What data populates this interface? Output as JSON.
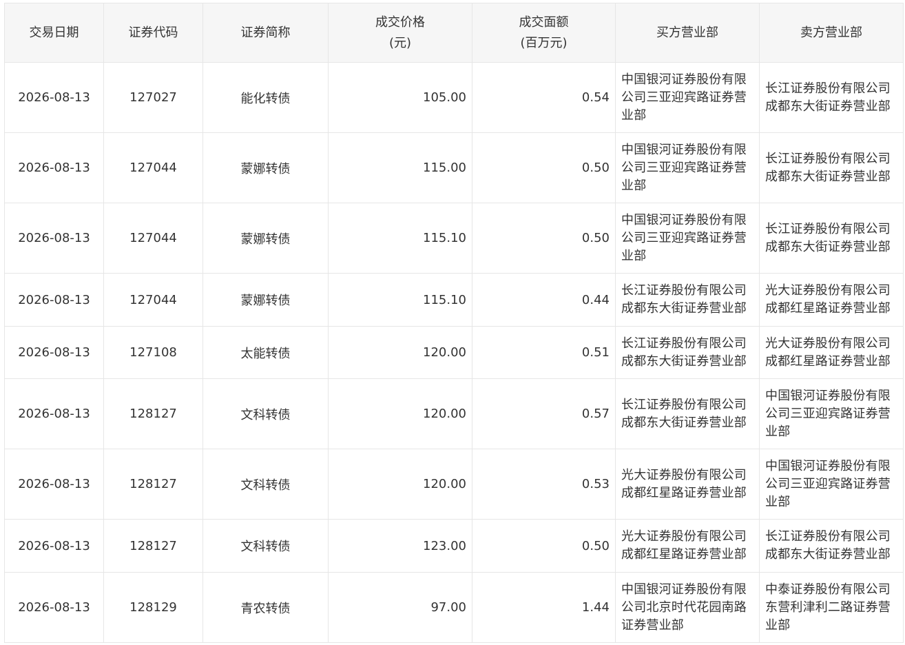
{
  "table": {
    "headers": {
      "date": "交易日期",
      "code": "证券代码",
      "name": "证券简称",
      "price_line1": "成交价格",
      "price_line2": "(元)",
      "amount_line1": "成交面额",
      "amount_line2": "(百万元)",
      "buyer": "买方营业部",
      "seller": "卖方营业部"
    },
    "rows": [
      {
        "date": "2026-08-13",
        "code": "127027",
        "name": "能化转债",
        "price": "105.00",
        "amount": "0.54",
        "buyer": "中国银河证券股份有限公司三亚迎宾路证券营业部",
        "seller": "长江证券股份有限公司成都东大街证券营业部"
      },
      {
        "date": "2026-08-13",
        "code": "127044",
        "name": "蒙娜转债",
        "price": "115.00",
        "amount": "0.50",
        "buyer": "中国银河证券股份有限公司三亚迎宾路证券营业部",
        "seller": "长江证券股份有限公司成都东大街证券营业部"
      },
      {
        "date": "2026-08-13",
        "code": "127044",
        "name": "蒙娜转债",
        "price": "115.10",
        "amount": "0.50",
        "buyer": "中国银河证券股份有限公司三亚迎宾路证券营业部",
        "seller": "长江证券股份有限公司成都东大街证券营业部"
      },
      {
        "date": "2026-08-13",
        "code": "127044",
        "name": "蒙娜转债",
        "price": "115.10",
        "amount": "0.44",
        "buyer": "长江证券股份有限公司成都东大街证券营业部",
        "seller": "光大证券股份有限公司成都红星路证券营业部"
      },
      {
        "date": "2026-08-13",
        "code": "127108",
        "name": "太能转债",
        "price": "120.00",
        "amount": "0.51",
        "buyer": "长江证券股份有限公司成都东大街证券营业部",
        "seller": "光大证券股份有限公司成都红星路证券营业部"
      },
      {
        "date": "2026-08-13",
        "code": "128127",
        "name": "文科转债",
        "price": "120.00",
        "amount": "0.57",
        "buyer": "长江证券股份有限公司成都东大街证券营业部",
        "seller": "中国银河证券股份有限公司三亚迎宾路证券营业部"
      },
      {
        "date": "2026-08-13",
        "code": "128127",
        "name": "文科转债",
        "price": "120.00",
        "amount": "0.53",
        "buyer": "光大证券股份有限公司成都红星路证券营业部",
        "seller": "中国银河证券股份有限公司三亚迎宾路证券营业部"
      },
      {
        "date": "2026-08-13",
        "code": "128127",
        "name": "文科转债",
        "price": "123.00",
        "amount": "0.50",
        "buyer": "光大证券股份有限公司成都红星路证券营业部",
        "seller": "长江证券股份有限公司成都东大街证券营业部"
      },
      {
        "date": "2026-08-13",
        "code": "128129",
        "name": "青农转债",
        "price": "97.00",
        "amount": "1.44",
        "buyer": "中国银河证券股份有限公司北京时代花园南路证券营业部",
        "seller": "中泰证券股份有限公司东营利津利二路证券营业部"
      }
    ]
  }
}
